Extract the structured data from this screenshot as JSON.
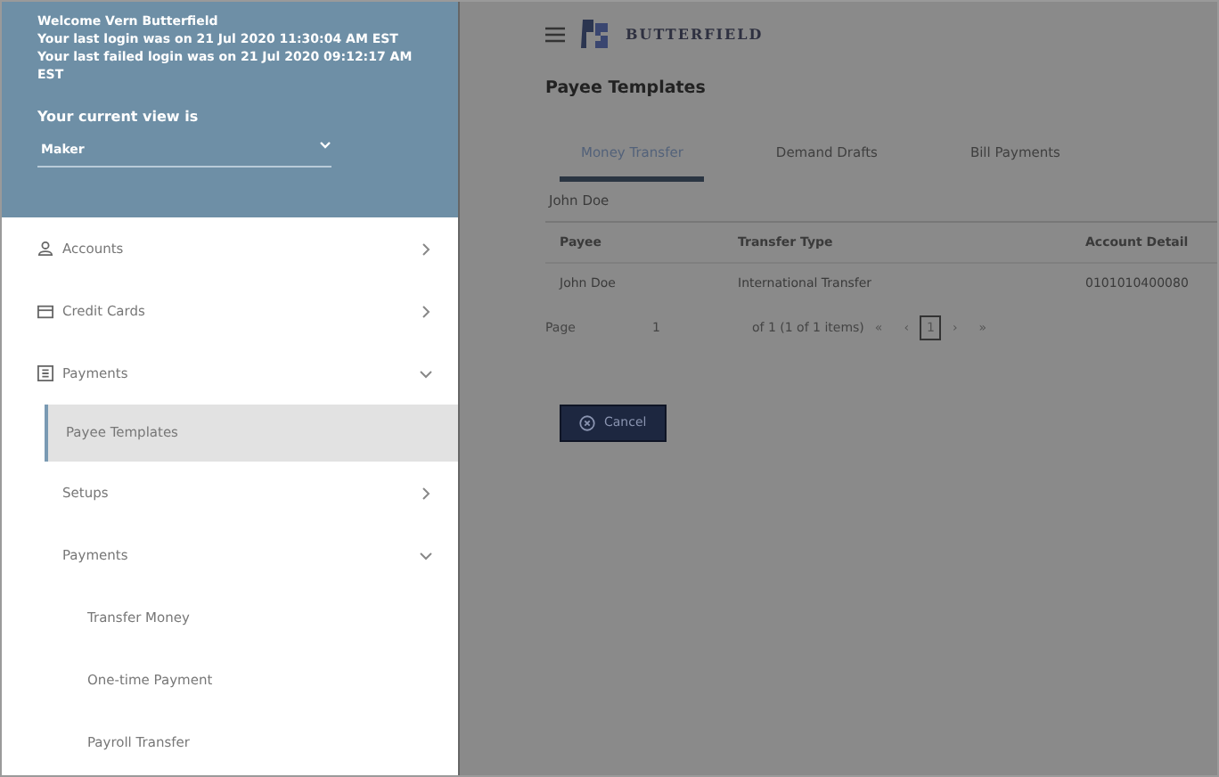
{
  "sidebar": {
    "welcome": "Welcome Vern Butterfield",
    "last_login": "Your last login was on 21 Jul 2020 11:30:04 AM EST",
    "last_failed_login": "Your last failed login was on 21 Jul 2020 09:12:17 AM EST",
    "view_label": "Your current view is",
    "view_value": "Maker",
    "items": [
      {
        "label": "Accounts",
        "expanded": false
      },
      {
        "label": "Credit Cards",
        "expanded": false
      },
      {
        "label": "Payments",
        "expanded": true,
        "children": [
          {
            "label": "Payee Templates",
            "selected": true
          },
          {
            "label": "Setups",
            "selected": false,
            "expanded": false
          },
          {
            "label": "Payments",
            "selected": false,
            "expanded": true,
            "children": [
              {
                "label": "Transfer Money",
                "selected": false
              },
              {
                "label": "One-time Payment",
                "selected": false
              },
              {
                "label": "Payroll Transfer",
                "selected": false
              }
            ]
          }
        ]
      }
    ]
  },
  "header": {
    "brand": "BUTTERFIELD"
  },
  "page_title": "Payee Templates",
  "tabs": [
    {
      "label": "Money Transfer",
      "selected": true
    },
    {
      "label": "Demand Drafts",
      "selected": false
    },
    {
      "label": "Bill Payments",
      "selected": false
    }
  ],
  "group_name": "John Doe",
  "table": {
    "columns": [
      "Payee",
      "Transfer Type",
      "Account Detail"
    ],
    "rows": [
      [
        "John Doe",
        "International Transfer",
        "0101010400080"
      ]
    ]
  },
  "pager": {
    "page_label": "Page",
    "page_value": "1",
    "summary": "of 1  (1 of 1 items)",
    "first": "«",
    "prev": "‹",
    "pages": [
      {
        "label": "1",
        "selected": true
      }
    ],
    "next": "›",
    "last": "»"
  },
  "buttons": [
    {
      "label": "Cancel"
    }
  ]
}
